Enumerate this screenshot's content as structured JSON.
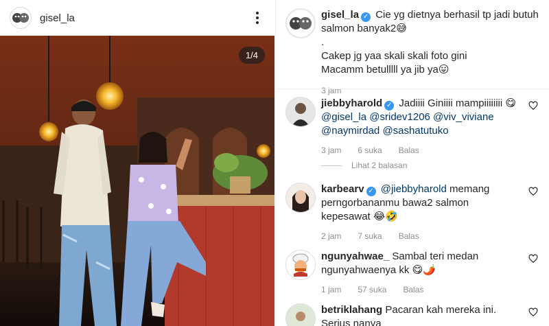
{
  "post": {
    "username": "gisel_la",
    "counter": "1/4"
  },
  "caption": {
    "username": "gisel_la",
    "line1": "Cie yg dietnya berhasil tp jadi butuh salmon banyak2😅",
    "line2": ".",
    "line3": "Cakep jg yaa skali skali foto gini",
    "line4": "Macamm betulllll ya jib ya😛",
    "time": "3 jam"
  },
  "comments": [
    {
      "username": "jiebbyharold",
      "verified": true,
      "text_a": "Jadiiii Giniiii mampiiiiiiii",
      "text_b": "😋",
      "mentions": [
        "@gisel_la",
        "@sridev1206",
        "@viv_viviane",
        "@naymirdad",
        "@sashatutuko"
      ],
      "time": "3 jam",
      "likes": "6 suka",
      "reply": "Balas"
    },
    {
      "username": "karbearv",
      "verified": true,
      "mention": "@jiebbyharold",
      "text": "memang perngorbananmu bawa2 salmon kepesawat 😂🤣",
      "time": "2 jam",
      "likes": "7 suka",
      "reply": "Balas"
    },
    {
      "username": "ngunyahwae_",
      "verified": false,
      "text": "Sambal teri medan ngunyahwaenya kk 😋🌶️",
      "time": "1 jam",
      "likes": "57 suka",
      "reply": "Balas"
    },
    {
      "username": "betriklahang",
      "verified": false,
      "text": "Pacaran kah mereka ini. Serius nanya"
    }
  ],
  "view_replies": "Lihat 2 balasan",
  "colors": {
    "verified": "#3897f0",
    "mention": "#00376b",
    "muted": "#8e8e8e"
  }
}
